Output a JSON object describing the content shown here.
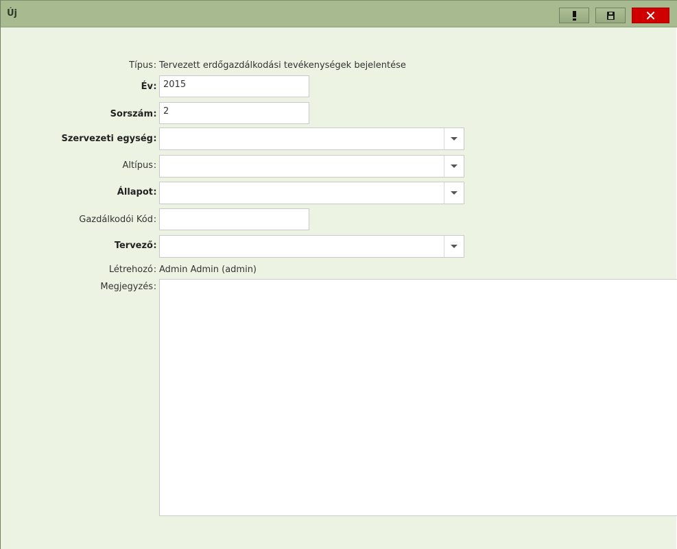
{
  "window": {
    "title": "Új",
    "buttons": {
      "alert_icon": "exclamation-icon",
      "save_icon": "floppy-icon",
      "close_icon": "close-icon",
      "close_glyph": "✕"
    }
  },
  "form": {
    "colon": ":",
    "tipus": {
      "label": "Típus",
      "value": "Tervezett erdőgazdálkodási tevékenységek bejelentése"
    },
    "ev": {
      "label": "Év",
      "value": "2015"
    },
    "sorszam": {
      "label": "Sorszám",
      "value": "2"
    },
    "szervezeti_egyseg": {
      "label": "Szervezeti egység",
      "value": ""
    },
    "altipus": {
      "label": "Altípus",
      "value": ""
    },
    "allapot": {
      "label": "Állapot",
      "value": ""
    },
    "gazdalkodoi_kod": {
      "label": "Gazdálkodói Kód",
      "value": ""
    },
    "tervezo": {
      "label": "Tervező",
      "value": ""
    },
    "letrehozo": {
      "label": "Létrehozó",
      "value": "Admin Admin (admin)"
    },
    "megjegyzes": {
      "label": "Megjegyzés",
      "value": ""
    }
  },
  "colors": {
    "title_bar": "#a8bb90",
    "window_bg": "#ecf3e3",
    "close_button": "#d10000"
  }
}
